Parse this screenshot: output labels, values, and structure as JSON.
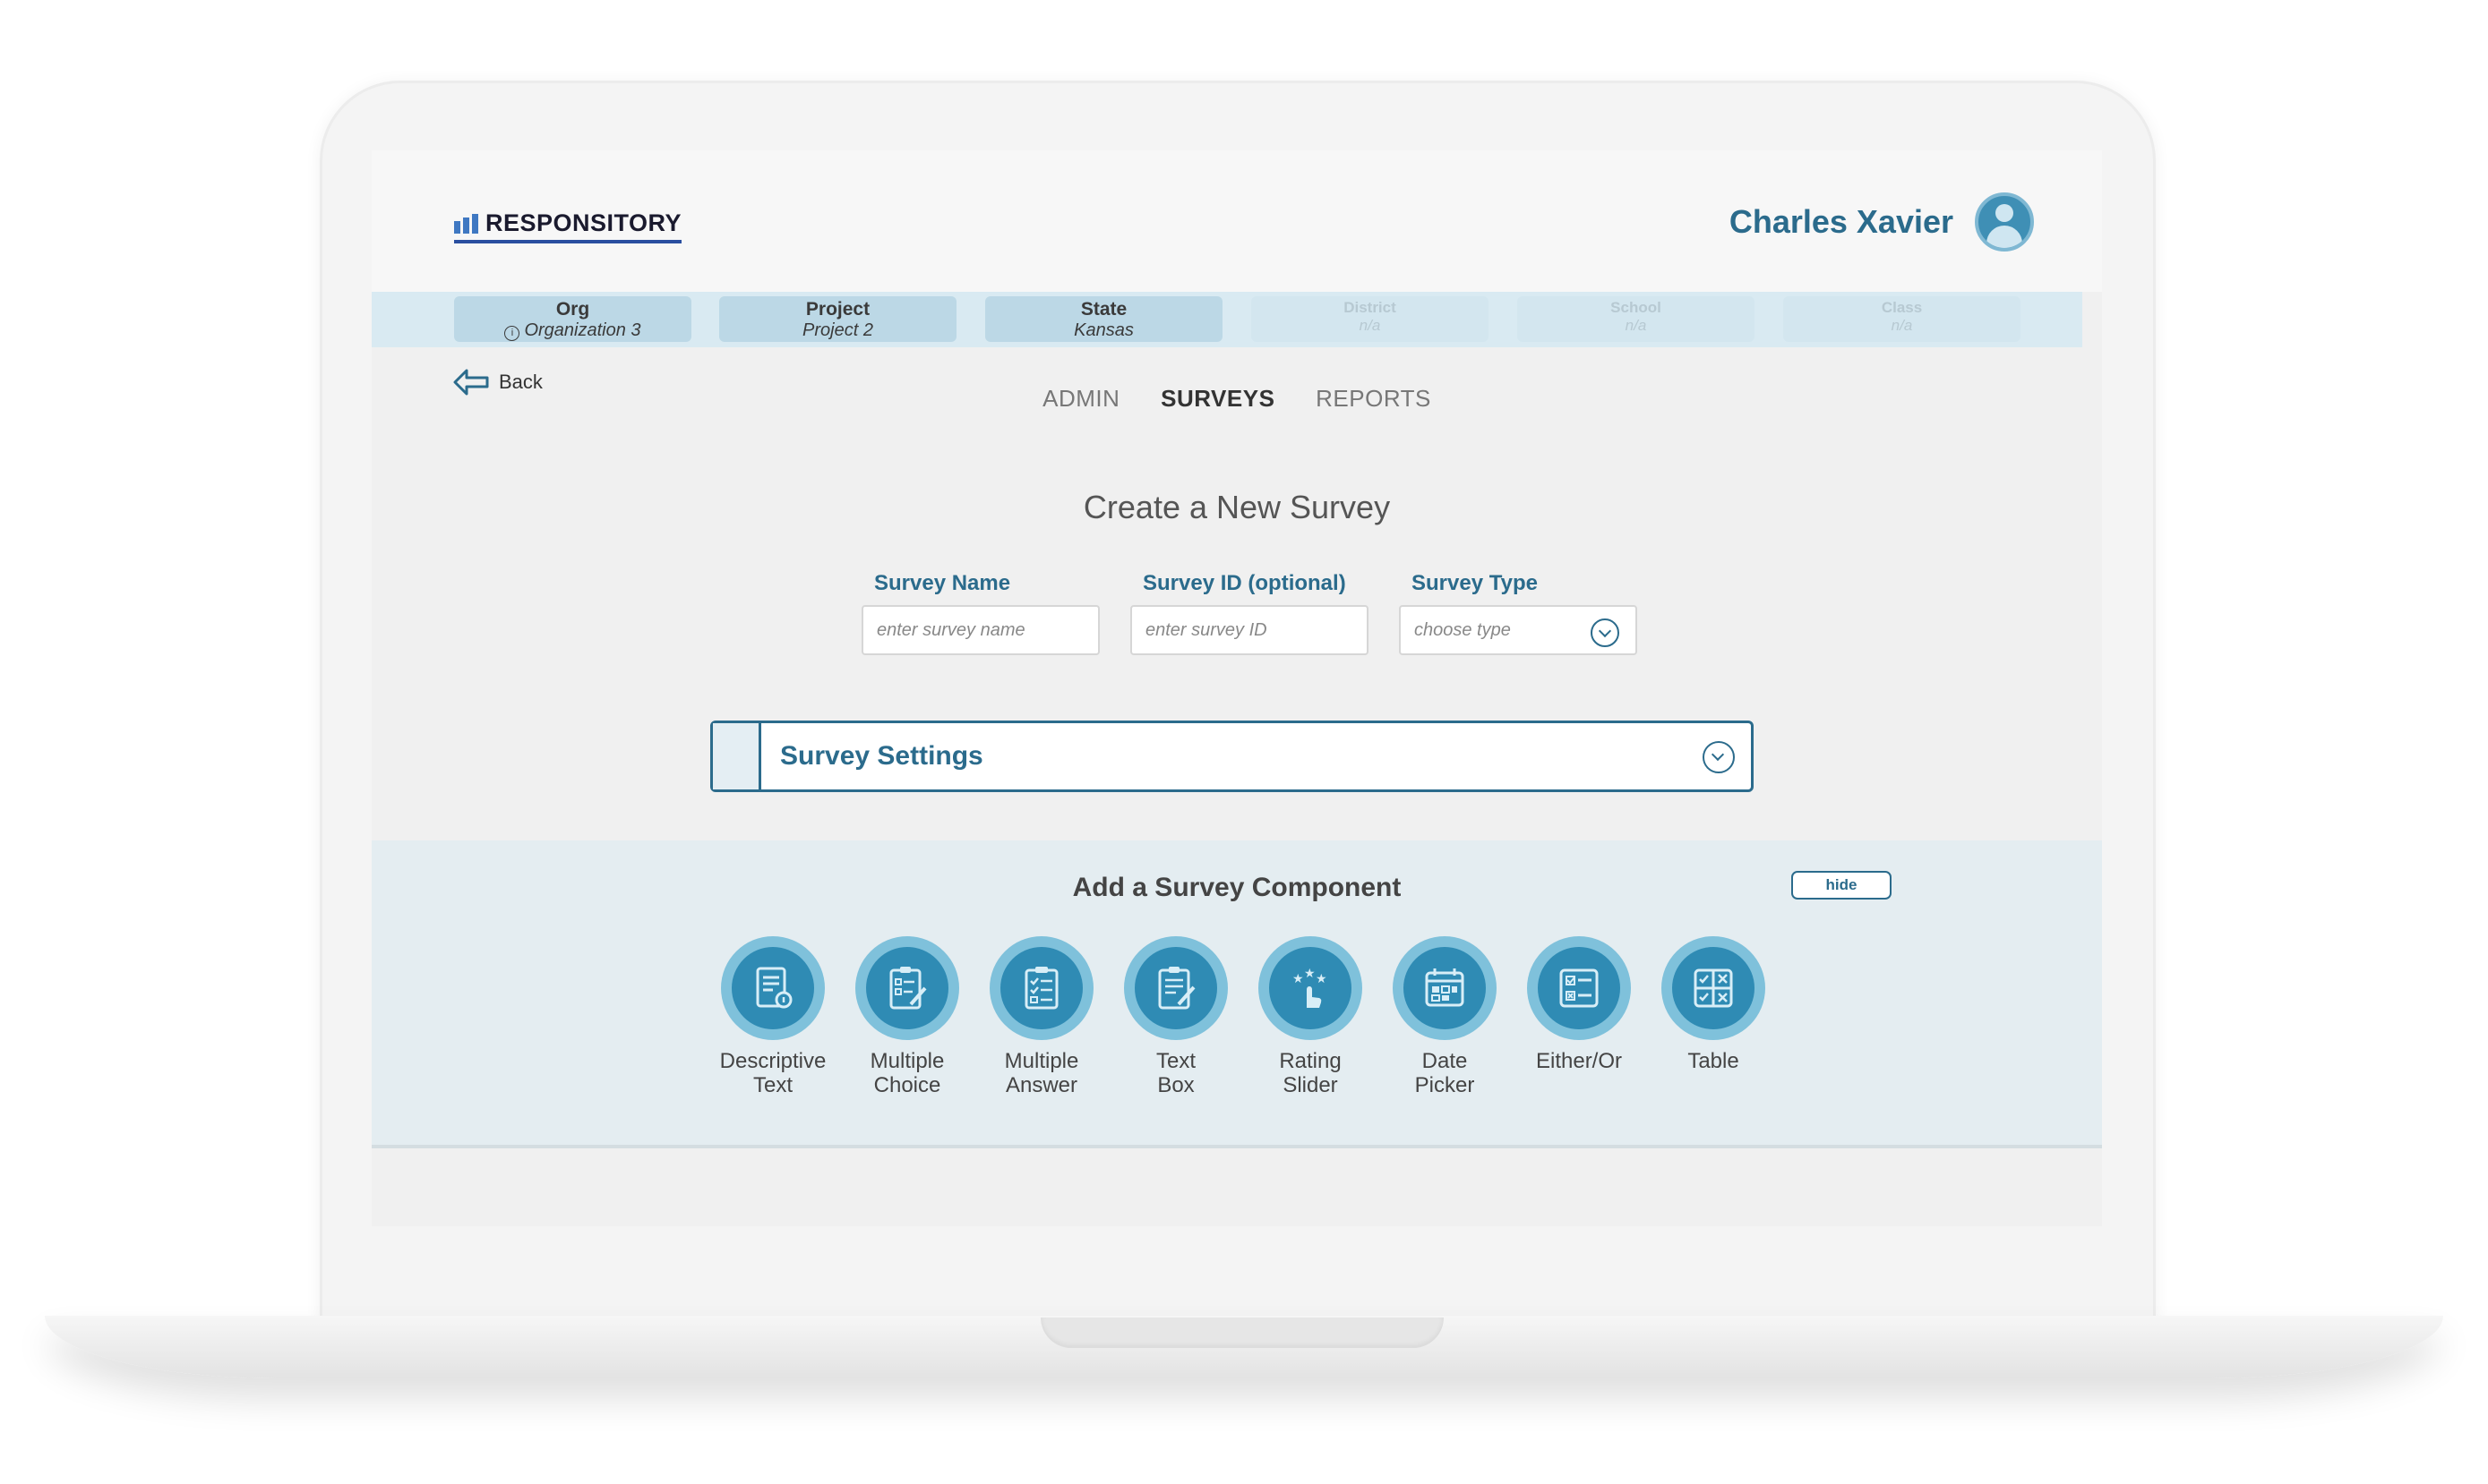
{
  "app": {
    "logo_text": "RESPONSITORY"
  },
  "user": {
    "name": "Charles Xavier"
  },
  "breadcrumbs": [
    {
      "label": "Org",
      "value": "Organization 3",
      "icon": "info-icon"
    },
    {
      "label": "Project",
      "value": "Project 2"
    },
    {
      "label": "State",
      "value": "Kansas"
    },
    {
      "label": "District",
      "value": "n/a"
    },
    {
      "label": "School",
      "value": "n/a"
    },
    {
      "label": "Class",
      "value": "n/a"
    }
  ],
  "back_label": "Back",
  "nav": {
    "admin": "ADMIN",
    "surveys": "SURVEYS",
    "reports": "REPORTS",
    "active": "SURVEYS"
  },
  "page_title": "Create a New Survey",
  "form": {
    "survey_name": {
      "label": "Survey Name",
      "placeholder": "enter survey name"
    },
    "survey_id": {
      "label": "Survey ID (optional)",
      "placeholder": "enter survey ID"
    },
    "survey_type": {
      "label": "Survey Type",
      "placeholder": "choose type"
    }
  },
  "settings": {
    "title": "Survey Settings"
  },
  "components": {
    "title": "Add a Survey Component",
    "hide_label": "hide",
    "items": [
      {
        "line1": "Descriptive",
        "line2": "Text",
        "icon": "descriptive-text-icon"
      },
      {
        "line1": "Multiple",
        "line2": "Choice",
        "icon": "multiple-choice-icon"
      },
      {
        "line1": "Multiple",
        "line2": "Answer",
        "icon": "multiple-answer-icon"
      },
      {
        "line1": "Text",
        "line2": "Box",
        "icon": "text-box-icon"
      },
      {
        "line1": "Rating",
        "line2": "Slider",
        "icon": "rating-slider-icon"
      },
      {
        "line1": "Date",
        "line2": "Picker",
        "icon": "date-picker-icon"
      },
      {
        "line1": "Either/Or",
        "line2": "",
        "icon": "either-or-icon"
      },
      {
        "line1": "Table",
        "line2": "",
        "icon": "table-icon"
      }
    ]
  },
  "colors": {
    "accent": "#2b6b8c",
    "icon_fill": "#2f8bb4",
    "icon_ring": "#7fc1db",
    "breadcrumb_bar": "#d9eaf2"
  }
}
